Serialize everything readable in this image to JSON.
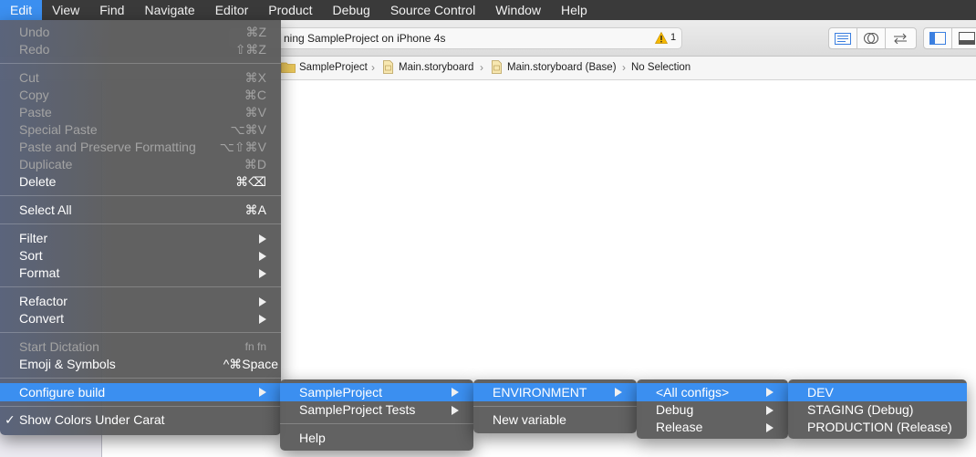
{
  "menubar": {
    "items": [
      "Edit",
      "View",
      "Find",
      "Navigate",
      "Editor",
      "Product",
      "Debug",
      "Source Control",
      "Window",
      "Help"
    ],
    "active": "Edit"
  },
  "toolbar": {
    "activity_text": "ning SampleProject on iPhone 4s",
    "warning_count": "1"
  },
  "jumpbar": {
    "crumbs": [
      "SampleProject",
      "Main.storyboard",
      "Main.storyboard (Base)",
      "No Selection"
    ]
  },
  "edit_menu": {
    "undo": {
      "label": "Undo",
      "shortcut": "⌘Z"
    },
    "redo": {
      "label": "Redo",
      "shortcut": "⇧⌘Z"
    },
    "cut": {
      "label": "Cut",
      "shortcut": "⌘X"
    },
    "copy": {
      "label": "Copy",
      "shortcut": "⌘C"
    },
    "paste": {
      "label": "Paste",
      "shortcut": "⌘V"
    },
    "special_paste": {
      "label": "Special Paste",
      "shortcut": "⌥⌘V"
    },
    "paste_preserve": {
      "label": "Paste and Preserve Formatting",
      "shortcut": "⌥⇧⌘V"
    },
    "duplicate": {
      "label": "Duplicate",
      "shortcut": "⌘D"
    },
    "delete": {
      "label": "Delete",
      "shortcut": "⌘⌫"
    },
    "select_all": {
      "label": "Select All",
      "shortcut": "⌘A"
    },
    "filter": {
      "label": "Filter"
    },
    "sort": {
      "label": "Sort"
    },
    "format": {
      "label": "Format"
    },
    "refactor": {
      "label": "Refactor"
    },
    "convert": {
      "label": "Convert"
    },
    "start_dictation": {
      "label": "Start Dictation",
      "shortcut": "fn fn"
    },
    "emoji": {
      "label": "Emoji & Symbols",
      "shortcut": "^⌘Space"
    },
    "configure_build": {
      "label": "Configure build"
    },
    "show_colors": {
      "label": "Show Colors Under Carat",
      "check": "✓"
    }
  },
  "submenu_project": {
    "items": [
      "SampleProject",
      "SampleProject Tests"
    ],
    "help": "Help"
  },
  "submenu_target": {
    "environment": "ENVIRONMENT",
    "new_variable": "New variable"
  },
  "submenu_configs": {
    "items": [
      "<All configs>",
      "Debug",
      "Release"
    ]
  },
  "submenu_envs": {
    "items": [
      "DEV",
      "STAGING (Debug)",
      "PRODUCTION (Release)"
    ]
  },
  "colors": {
    "highlight": "#3b8ff0",
    "menubar": "#3a3a3a",
    "menu_bg": "#5d5d5d",
    "warning": "#f5b800"
  },
  "icons": {
    "toolbar_editor": "standard-editor-icon",
    "toolbar_assistant": "assistant-editor-icon",
    "toolbar_version": "version-editor-icon",
    "toolbar_navigator": "navigator-toggle-icon",
    "toolbar_debug": "debug-area-toggle-icon",
    "folder": "folder-icon",
    "storyboard": "storyboard-file-icon",
    "warning": "warning-icon"
  }
}
